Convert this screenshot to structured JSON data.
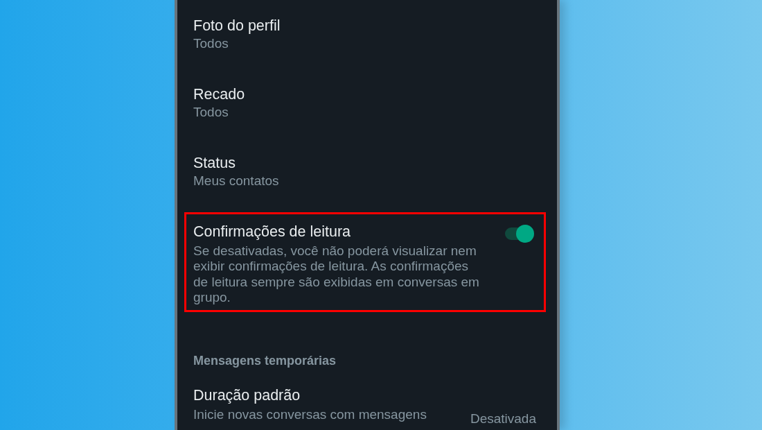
{
  "settings": [
    {
      "kind": "value",
      "title": "Foto do perfil",
      "value": "Todos",
      "highlighted": false
    },
    {
      "kind": "value",
      "title": "Recado",
      "value": "Todos",
      "highlighted": false
    },
    {
      "kind": "value",
      "title": "Status",
      "value": "Meus contatos",
      "highlighted": false
    },
    {
      "kind": "toggle",
      "title": "Confirmações de leitura",
      "description": "Se desativadas, você não poderá visualizar nem exibir confirmações de leitura. As confirmações de leitura sempre são exibidas em conversas em grupo.",
      "on": true,
      "highlighted": true
    }
  ],
  "section": {
    "header": "Mensagens temporárias",
    "items": [
      {
        "title": "Duração padrão",
        "description": "Inicie novas conversas com mensagens",
        "value": "Desativada"
      }
    ]
  }
}
